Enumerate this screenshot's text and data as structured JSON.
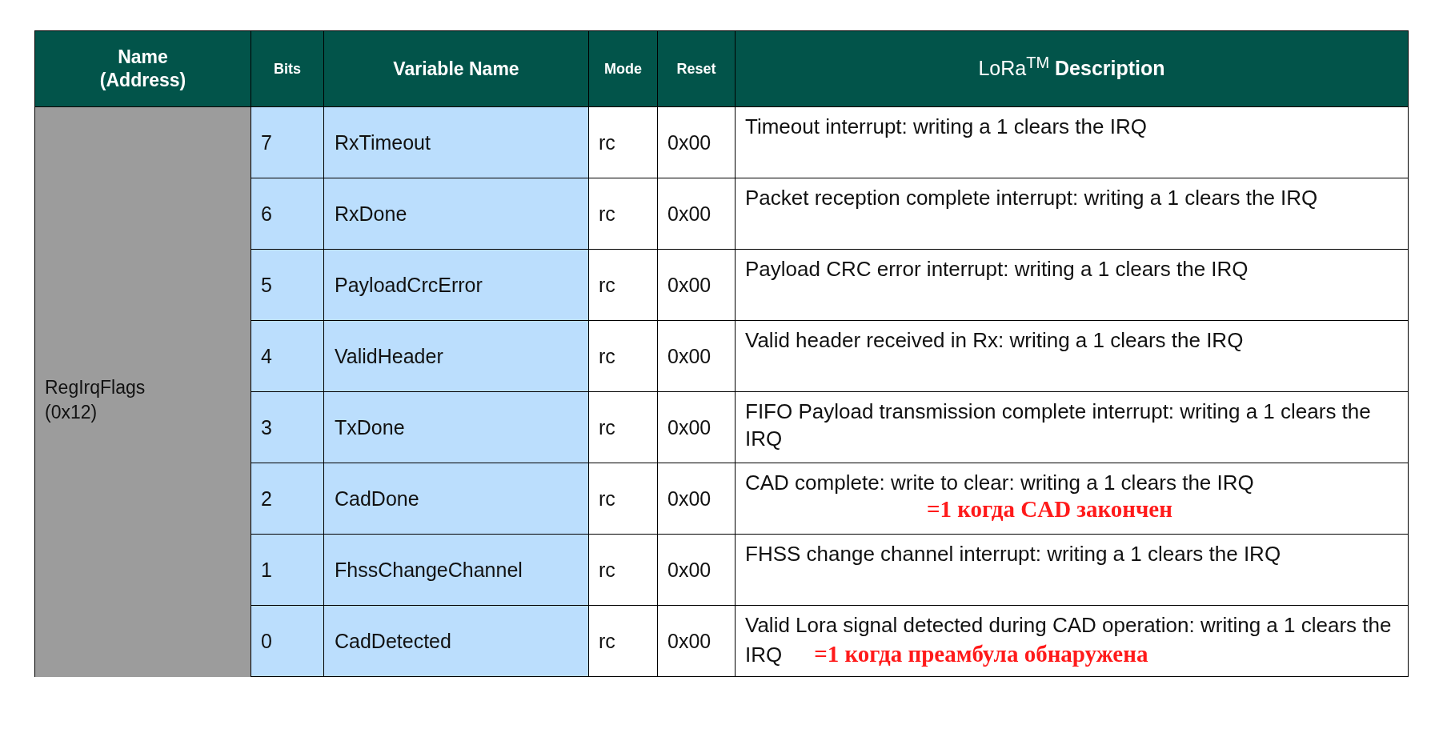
{
  "table": {
    "columns": [
      "Name\n(Address)",
      "Bits",
      "Variable Name",
      "Mode",
      "Reset",
      "LoRa$^{TM}$ **Description**"
    ],
    "register": {
      "name": "RegIrqFlags",
      "address": "(0x12)"
    },
    "rows": [
      {
        "bits": "7",
        "variable": "RxTimeout",
        "mode": "rc",
        "reset": "0x00",
        "description": "Timeout interrupt: writing a 1 clears the IRQ"
      },
      {
        "bits": "6",
        "variable": "RxDone",
        "mode": "rc",
        "reset": "0x00",
        "description": "Packet reception complete interrupt: writing a 1 clears the IRQ"
      },
      {
        "bits": "5",
        "variable": "PayloadCrcError",
        "mode": "rc",
        "reset": "0x00",
        "description": "Payload CRC error interrupt: writing a 1 clears the IRQ"
      },
      {
        "bits": "4",
        "variable": "ValidHeader",
        "mode": "rc",
        "reset": "0x00",
        "description": "Valid header received in Rx: writing a 1 clears the IRQ"
      },
      {
        "bits": "3",
        "variable": "TxDone",
        "mode": "rc",
        "reset": "0x00",
        "description": "FIFO Payload transmission complete interrupt: writing a 1 clears the IRQ"
      },
      {
        "bits": "2",
        "variable": "CadDone",
        "mode": "rc",
        "reset": "0x00",
        "description": "CAD complete: write to clear: writing a 1 clears the IRQ",
        "note": {
          "kind": "block",
          "text": "=1 когда CAD закончен"
        }
      },
      {
        "bits": "1",
        "variable": "FhssChangeChannel",
        "mode": "rc",
        "reset": "0x00",
        "description": "FHSS change channel interrupt: writing a 1 clears the IRQ"
      },
      {
        "bits": "0",
        "variable": "CadDetected",
        "mode": "rc",
        "reset": "0x00",
        "description": "Valid Lora signal detected during CAD operation: writing a 1 clears the IRQ",
        "note": {
          "kind": "inline",
          "text": "=1 когда преамбула обнаружена"
        }
      }
    ]
  }
}
